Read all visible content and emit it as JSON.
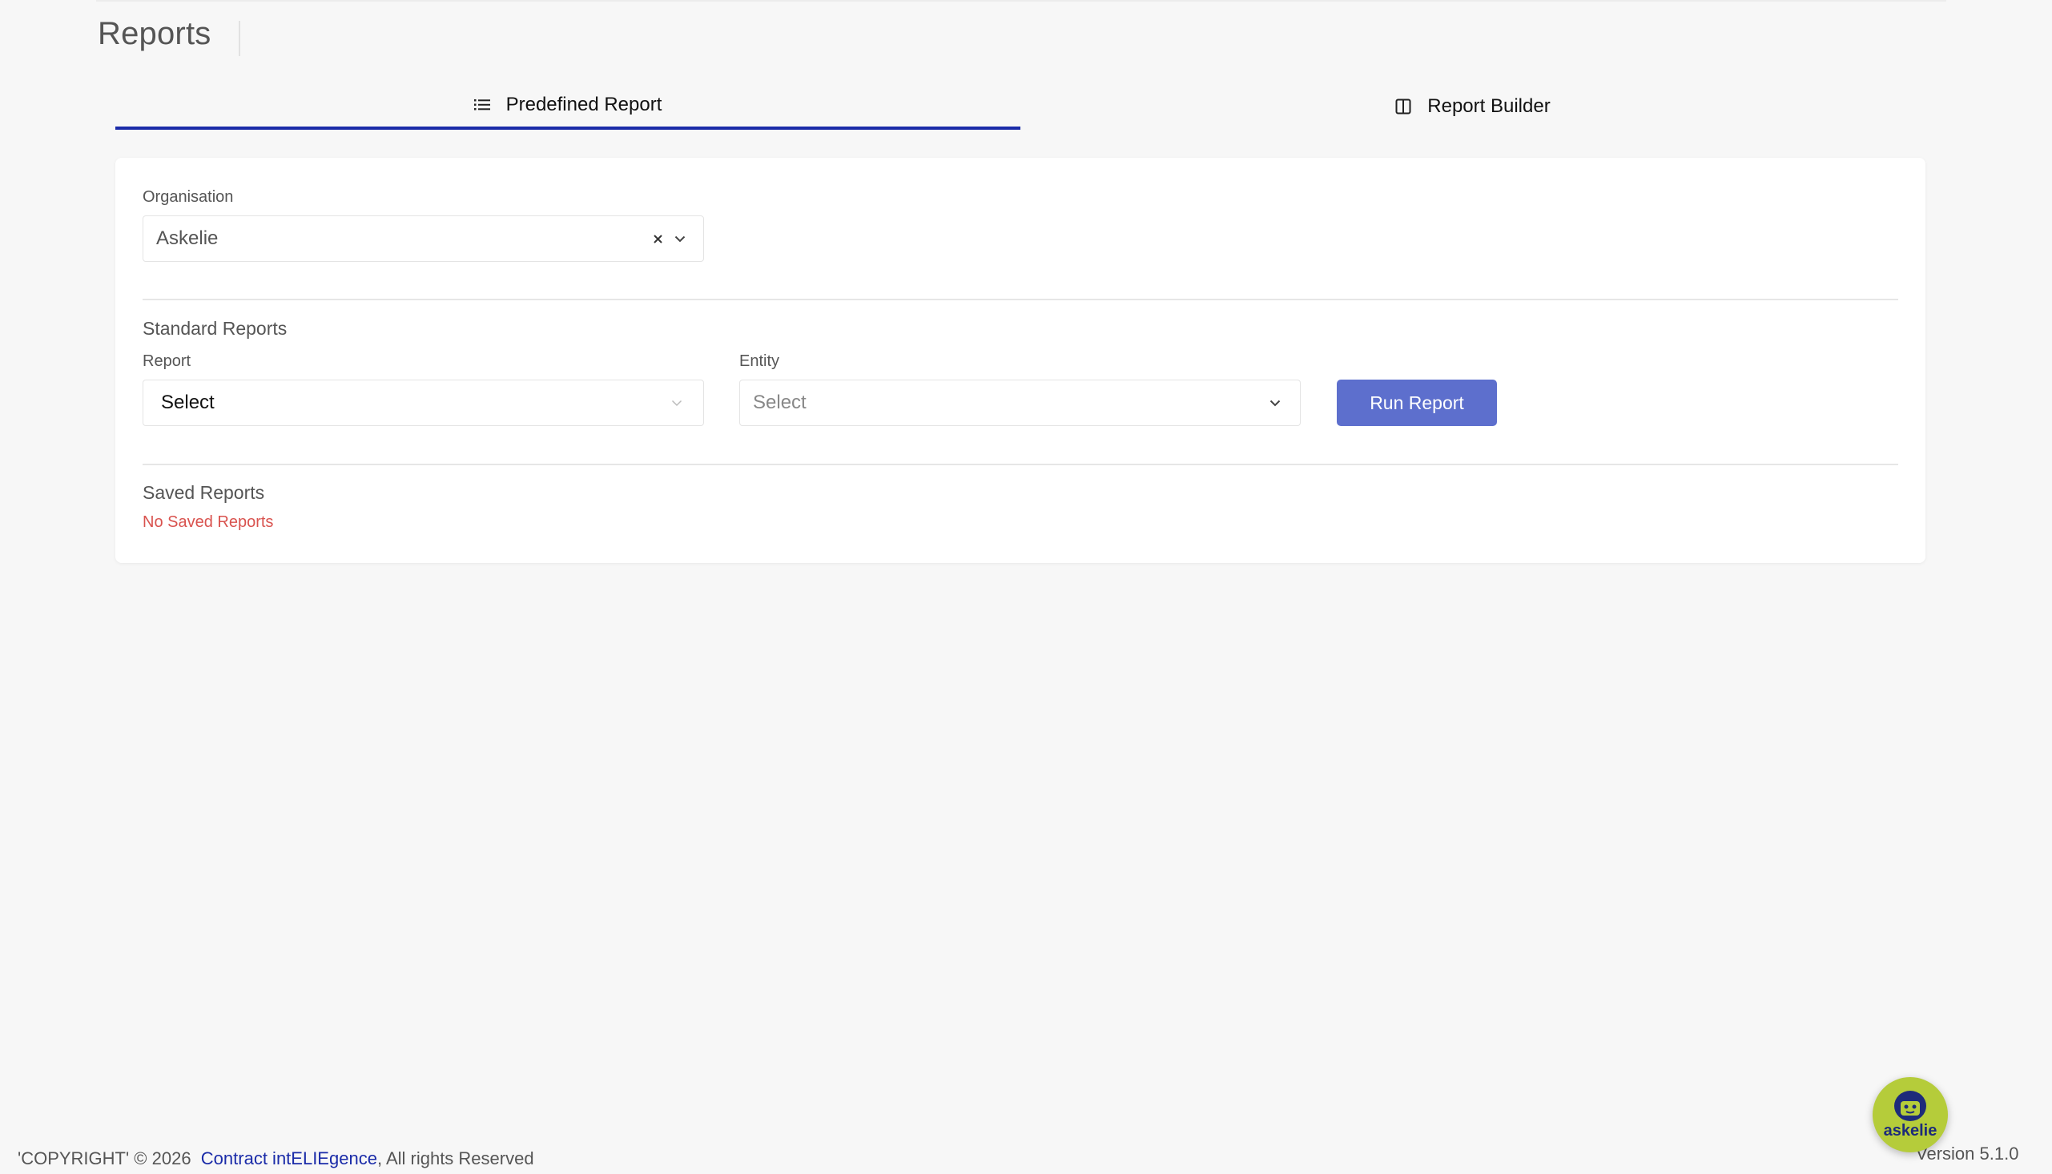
{
  "page": {
    "title": "Reports"
  },
  "tabs": [
    {
      "label": "Predefined Report",
      "icon": "list-icon",
      "active": true
    },
    {
      "label": "Report Builder",
      "icon": "columns-icon",
      "active": false
    }
  ],
  "organisation": {
    "label": "Organisation",
    "value": "Askelie"
  },
  "standard_reports": {
    "title": "Standard Reports",
    "report": {
      "label": "Report",
      "value": "Select"
    },
    "entity": {
      "label": "Entity",
      "placeholder": "Select"
    },
    "run_button": "Run Report"
  },
  "saved_reports": {
    "title": "Saved Reports",
    "empty_message": "No Saved Reports"
  },
  "footer": {
    "copyright": "'COPYRIGHT' © 2026",
    "company_link": "Contract intELIEgence",
    "rights": ", All rights Reserved",
    "version": "Version 5.1.0"
  },
  "chat_widget": {
    "label": "askelie"
  },
  "colors": {
    "accent": "#1a2ba8",
    "button": "#5d6fcd",
    "error": "#d9534f",
    "widget": "#b5cc3a"
  }
}
